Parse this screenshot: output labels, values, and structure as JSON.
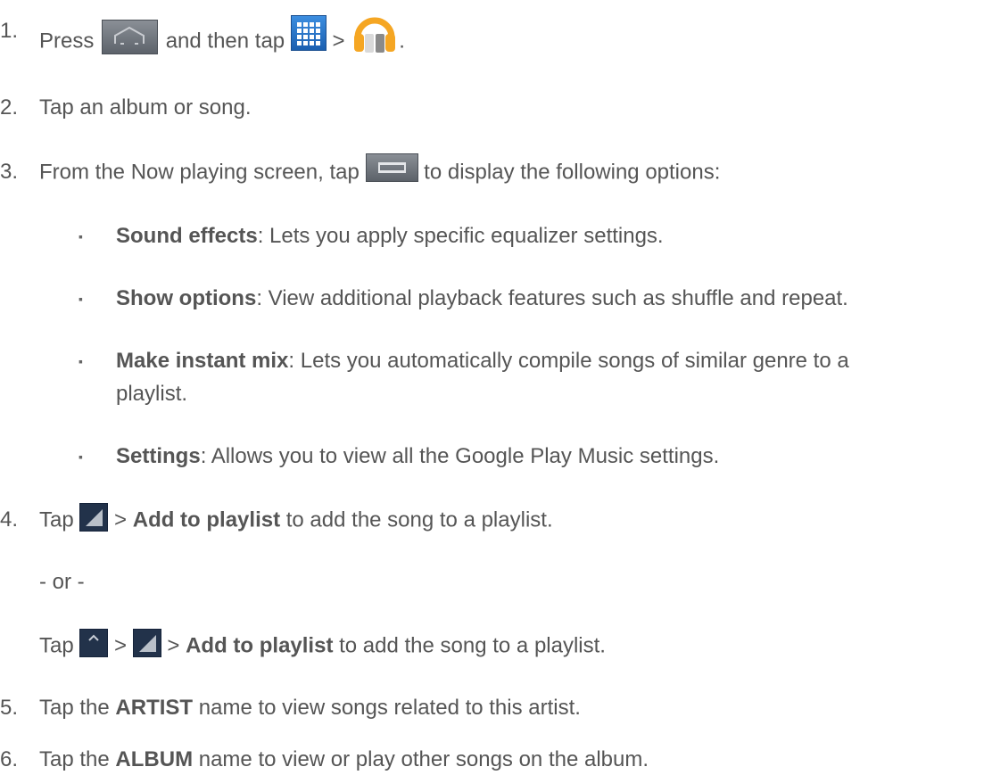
{
  "steps": [
    {
      "num": "1.",
      "press": "Press",
      "then_tap": "and then tap",
      "sep": ">",
      "end": "."
    },
    {
      "num": "2.",
      "text": "Tap an album or song."
    },
    {
      "num": "3.",
      "pre": "From the Now playing screen, tap",
      "post": "to display the following options:"
    },
    {
      "num": "4.",
      "tap": "Tap",
      "sep": ">",
      "bold": "Add to playlist",
      "post": "to add the song to a playlist.",
      "or": "- or -",
      "alt": {
        "tap": "Tap",
        "sep1": ">",
        "sep2": ">",
        "bold": "Add to playlist",
        "post": "to add the song to a playlist."
      }
    },
    {
      "num": "5.",
      "pre": "Tap the",
      "bold": "ARTIST",
      "post": "name to view songs related to this artist."
    },
    {
      "num": "6.",
      "pre": "Tap the",
      "bold": "ALBUM",
      "post": "name to view or play other songs on the album."
    }
  ],
  "options": [
    {
      "bullet": "▪",
      "term": "Sound effects",
      "desc": ": Lets you apply specific equalizer settings."
    },
    {
      "bullet": "▪",
      "term": "Show options",
      "desc": ": View additional playback features such as shuffle and repeat."
    },
    {
      "bullet": "▪",
      "term": "Make instant mix",
      "desc": ": Lets you automatically compile songs of similar genre to a",
      "desc2": "playlist."
    },
    {
      "bullet": "▪",
      "term": "Settings",
      "desc": ": Allows you to view all the Google Play Music settings."
    }
  ],
  "icons": {
    "home": "home-icon",
    "apps": "apps-grid-icon",
    "music": "play-music-headphones-icon",
    "menu": "menu-icon",
    "overflow": "album-art-overflow-icon",
    "expand": "expand-up-icon",
    "colors": {
      "text": "#555555",
      "apps_blue": "#2a78cf",
      "music_orange": "#f5a623",
      "dark_square": "#22324a"
    }
  }
}
